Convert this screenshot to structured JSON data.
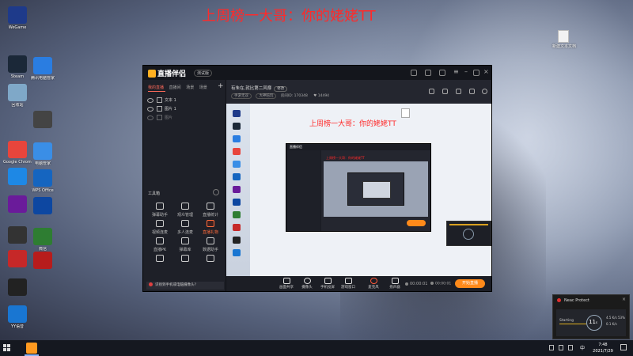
{
  "banner_text": "上周榜一大哥：你的姥姥TT",
  "desktop_icons": [
    {
      "label": "WeGame",
      "color": "#1e3a8a"
    },
    {
      "label": "Steam",
      "color": "#1b2838"
    },
    {
      "label": "腾讯电脑管家",
      "color": "#2a7de1"
    },
    {
      "label": "回收站",
      "color": "#7fa8c8"
    },
    {
      "label": "",
      "color": "#444444"
    },
    {
      "label": "Google Chrome",
      "color": "#e8453c"
    },
    {
      "label": "电脑管家",
      "color": "#3a8ee6"
    },
    {
      "label": "",
      "color": "#1e88e5"
    },
    {
      "label": "WPS Office",
      "color": "#1565c0"
    },
    {
      "label": "",
      "color": "#6a1b9a"
    },
    {
      "label": "",
      "color": "#0d47a1"
    },
    {
      "label": "",
      "color": "#333333"
    },
    {
      "label": "微信",
      "color": "#2e7d32"
    },
    {
      "label": "",
      "color": "#c62828"
    },
    {
      "label": "",
      "color": "#b71c1c"
    },
    {
      "label": "",
      "color": "#222222"
    },
    {
      "label": "YY语音",
      "color": "#1976d2"
    }
  ],
  "desktop_file": {
    "label": "新建文本文档"
  },
  "app": {
    "logo": "直播伴侣",
    "version": "测试版",
    "tabs": [
      "我的直播",
      "直播间",
      "场景",
      "场景"
    ],
    "sources": [
      "文本 1",
      "图片 1",
      "图片"
    ],
    "tools_title": "工具箱",
    "tools": [
      {
        "label": "弹幕助手",
        "highlight": false
      },
      {
        "label": "观众管理",
        "highlight": false
      },
      {
        "label": "直播统计",
        "highlight": false
      },
      {
        "label": "视频连麦",
        "highlight": false
      },
      {
        "label": "多人连麦",
        "highlight": false
      },
      {
        "label": "直播礼物",
        "highlight": true
      },
      {
        "label": "直播PK",
        "highlight": false
      },
      {
        "label": "弹幕库",
        "highlight": false
      },
      {
        "label": "数据助手",
        "highlight": false
      },
      {
        "label": "",
        "highlight": false
      },
      {
        "label": "",
        "highlight": false
      },
      {
        "label": "",
        "highlight": false
      }
    ],
    "left_notice": "识别到手机或电脑摄像头?",
    "room_title": "有朱在,就比第二风靡",
    "room_tag": "修改",
    "room_chips": [
      "手游无双",
      "大神陪玩"
    ],
    "room_id_label": "房间ID:",
    "room_id": "170348",
    "room_fans": "14494",
    "preview_banner": "上周榜一大哥：你的姥姥TT",
    "controls": [
      "画面共享",
      "摄像头",
      "手机投屏",
      "游戏窗口",
      "麦克风",
      "扬声器"
    ],
    "timer": "00:00:01",
    "timer2": "00:00:01",
    "go_live": "开始直播"
  },
  "notification": {
    "title": "Neac Protect",
    "status": "Starting",
    "value": "11",
    "unit": "s",
    "stat1": "4.5",
    "stat1_unit": "K/s",
    "stat2": "0.1",
    "stat2_unit": "K/s",
    "percent": "53%"
  },
  "taskbar": {
    "ime": "中",
    "time": "7:48",
    "date": "2021/7/29"
  }
}
